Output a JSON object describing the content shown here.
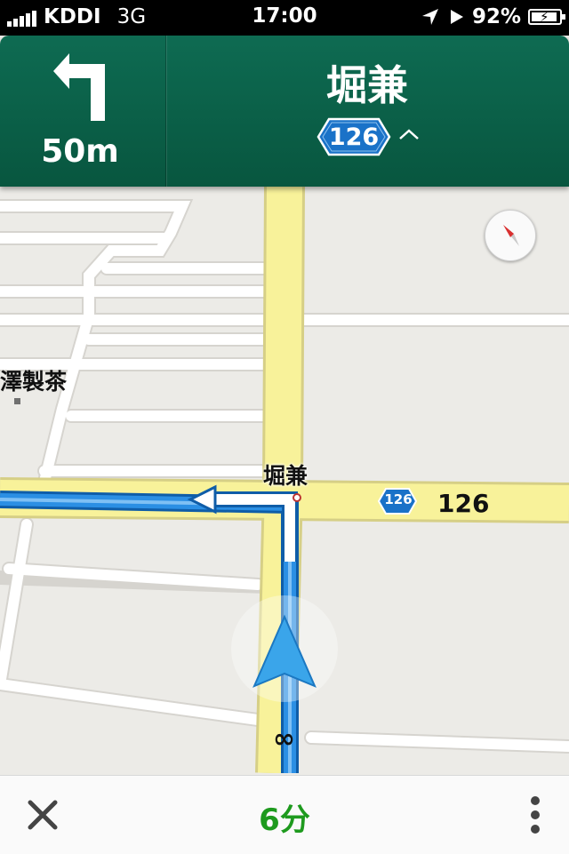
{
  "status_bar": {
    "carrier": "KDDI",
    "network": "3G",
    "time": "17:00",
    "battery": "92%",
    "battery_level": 0.92,
    "icons": [
      "signal-bars-icon",
      "location-arrow-icon",
      "play-icon",
      "battery-charging-icon"
    ]
  },
  "navigation": {
    "turn_icon": "turn-left-arrow-icon",
    "distance": "50m",
    "street": "堀兼",
    "route_number": "126",
    "route_caret": "^",
    "header_color": "#0b6149"
  },
  "map": {
    "labels": {
      "poi": "澤製茶",
      "intersection": "堀兼",
      "route_shield": "126",
      "route_road": "126",
      "marker": "∞"
    },
    "colors": {
      "background": "#ecebe7",
      "major_road": "#f8f29a",
      "minor_road": "#ffffff",
      "route_line": "#2b8fe4",
      "shield_blue": "#1976d2"
    },
    "compass_icon": "compass-icon",
    "position_icon": "navigation-arrow-icon"
  },
  "bottom_bar": {
    "close_icon": "close-icon",
    "eta": "6分",
    "eta_color": "#1e9a1e",
    "menu_icon": "more-vertical-icon"
  }
}
